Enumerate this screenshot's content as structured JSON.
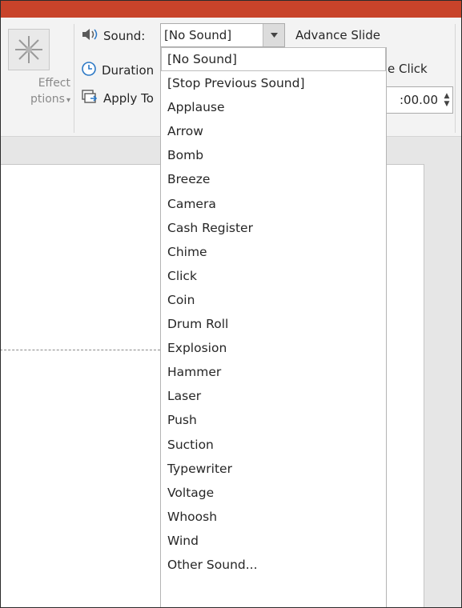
{
  "ribbon": {
    "effect_options": {
      "line1": "Effect",
      "line2": "ptions",
      "arrow": "▾"
    },
    "sound": {
      "label": "Sound:",
      "value": "[No Sound]"
    },
    "duration": {
      "label": "Duration"
    },
    "apply_to": {
      "label": "Apply To"
    },
    "advance_slide": {
      "label": "Advance Slide"
    },
    "on_click": {
      "label": "e Click"
    },
    "after_time": {
      "value": ":00.00"
    }
  },
  "sound_dropdown": {
    "options": [
      "[No Sound]",
      "[Stop Previous Sound]",
      "Applause",
      "Arrow",
      "Bomb",
      "Breeze",
      "Camera",
      "Cash Register",
      "Chime",
      "Click",
      "Coin",
      "Drum Roll",
      "Explosion",
      "Hammer",
      "Laser",
      "Push",
      "Suction",
      "Typewriter",
      "Voltage",
      "Whoosh",
      "Wind",
      "Other Sound..."
    ],
    "highlighted": "[No Sound]"
  },
  "colors": {
    "title_strip": "#c8432a",
    "ribbon_bg": "#f3f3f3",
    "workspace_bg": "#e6e6e6"
  },
  "icons": {
    "effect_options": "star-burst-icon",
    "sound": "speaker-icon",
    "duration": "clock-icon",
    "apply_to": "apply-to-all-icon",
    "dropdown_arrow": "chevron-down-icon",
    "spinner": "spinner-arrows-icon"
  }
}
